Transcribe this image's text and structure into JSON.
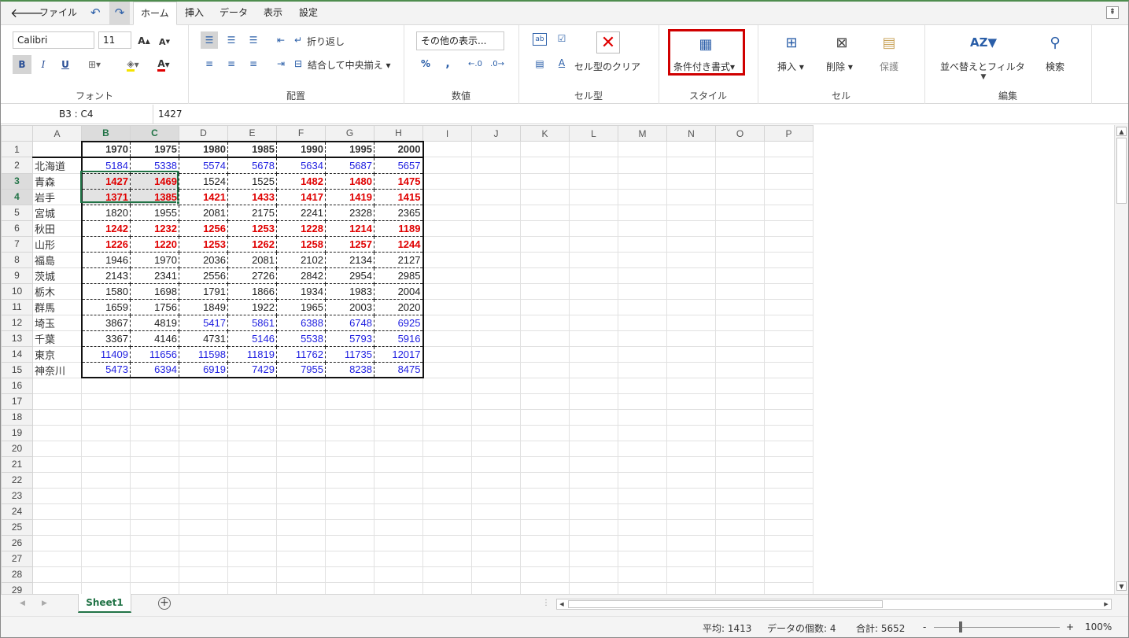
{
  "menu": {
    "back_icon": "back-arrow-icon",
    "file": "ファイル",
    "home": "ホーム",
    "insert": "挿入",
    "data": "データ",
    "view": "表示",
    "settings": "設定"
  },
  "ribbon": {
    "font": {
      "name": "Calibri",
      "size": "11",
      "title": "フォント"
    },
    "align": {
      "wrap": "折り返し",
      "merge": "結合して中央揃え",
      "title": "配置"
    },
    "number": {
      "format": "その他の表示...",
      "percent": "%",
      "comma": ",",
      "title": "数値"
    },
    "celltype": {
      "clear": "セル型のクリア",
      "title": "セル型"
    },
    "style": {
      "cond": "条件付き書式",
      "title": "スタイル",
      "highlight_color": "#d00000"
    },
    "cells": {
      "insert": "挿入",
      "delete": "削除",
      "protect": "保護",
      "title": "セル"
    },
    "edit": {
      "sort": "並べ替えとフィルタ",
      "find": "検索",
      "title": "編集"
    }
  },
  "formula": {
    "namebox": "B3 : C4",
    "value": "1427"
  },
  "columns": [
    "A",
    "B",
    "C",
    "D",
    "E",
    "F",
    "G",
    "H",
    "I",
    "J",
    "K",
    "L",
    "M",
    "N",
    "O",
    "P"
  ],
  "header_row": [
    "",
    "1970",
    "1975",
    "1980",
    "1985",
    "1990",
    "1995",
    "2000"
  ],
  "rows": [
    {
      "name": "北海道",
      "v": [
        "5184",
        "5338",
        "5574",
        "5678",
        "5634",
        "5687",
        "5657"
      ],
      "c": [
        "b",
        "b",
        "b",
        "b",
        "b",
        "b",
        "b"
      ]
    },
    {
      "name": "青森",
      "v": [
        "1427",
        "1469",
        "1524",
        "1525",
        "1482",
        "1480",
        "1475"
      ],
      "c": [
        "r",
        "r",
        "k",
        "k",
        "r",
        "r",
        "r"
      ]
    },
    {
      "name": "岩手",
      "v": [
        "1371",
        "1385",
        "1421",
        "1433",
        "1417",
        "1419",
        "1415"
      ],
      "c": [
        "r",
        "r",
        "r",
        "r",
        "r",
        "r",
        "r"
      ]
    },
    {
      "name": "宮城",
      "v": [
        "1820",
        "1955",
        "2081",
        "2175",
        "2241",
        "2328",
        "2365"
      ],
      "c": [
        "k",
        "k",
        "k",
        "k",
        "k",
        "k",
        "k"
      ]
    },
    {
      "name": "秋田",
      "v": [
        "1242",
        "1232",
        "1256",
        "1253",
        "1228",
        "1214",
        "1189"
      ],
      "c": [
        "r",
        "r",
        "r",
        "r",
        "r",
        "r",
        "r"
      ]
    },
    {
      "name": "山形",
      "v": [
        "1226",
        "1220",
        "1253",
        "1262",
        "1258",
        "1257",
        "1244"
      ],
      "c": [
        "r",
        "r",
        "r",
        "r",
        "r",
        "r",
        "r"
      ]
    },
    {
      "name": "福島",
      "v": [
        "1946",
        "1970",
        "2036",
        "2081",
        "2102",
        "2134",
        "2127"
      ],
      "c": [
        "k",
        "k",
        "k",
        "k",
        "k",
        "k",
        "k"
      ]
    },
    {
      "name": "茨城",
      "v": [
        "2143",
        "2341",
        "2556",
        "2726",
        "2842",
        "2954",
        "2985"
      ],
      "c": [
        "k",
        "k",
        "k",
        "k",
        "k",
        "k",
        "k"
      ]
    },
    {
      "name": "栃木",
      "v": [
        "1580",
        "1698",
        "1791",
        "1866",
        "1934",
        "1983",
        "2004"
      ],
      "c": [
        "k",
        "k",
        "k",
        "k",
        "k",
        "k",
        "k"
      ]
    },
    {
      "name": "群馬",
      "v": [
        "1659",
        "1756",
        "1849",
        "1922",
        "1965",
        "2003",
        "2020"
      ],
      "c": [
        "k",
        "k",
        "k",
        "k",
        "k",
        "k",
        "k"
      ]
    },
    {
      "name": "埼玉",
      "v": [
        "3867",
        "4819",
        "5417",
        "5861",
        "6388",
        "6748",
        "6925"
      ],
      "c": [
        "k",
        "k",
        "b",
        "b",
        "b",
        "b",
        "b"
      ]
    },
    {
      "name": "千葉",
      "v": [
        "3367",
        "4146",
        "4731",
        "5146",
        "5538",
        "5793",
        "5916"
      ],
      "c": [
        "k",
        "k",
        "k",
        "b",
        "b",
        "b",
        "b"
      ]
    },
    {
      "name": "東京",
      "v": [
        "11409",
        "11656",
        "11598",
        "11819",
        "11762",
        "11735",
        "12017"
      ],
      "c": [
        "b",
        "b",
        "b",
        "b",
        "b",
        "b",
        "b"
      ]
    },
    {
      "name": "神奈川",
      "v": [
        "5473",
        "6394",
        "6919",
        "7429",
        "7955",
        "8238",
        "8475"
      ],
      "c": [
        "b",
        "b",
        "b",
        "b",
        "b",
        "b",
        "b"
      ]
    }
  ],
  "total_rows": 29,
  "sheet": {
    "tab": "Sheet1",
    "add": "+"
  },
  "status": {
    "avg": "平均: 1413",
    "count": "データの個数: 4",
    "sum": "合計: 5652",
    "minus": "-",
    "plus": "+",
    "zoom": "100%"
  },
  "colors": {
    "blue": "#1f1fe0",
    "red": "#e00000",
    "accent": "#217346"
  }
}
